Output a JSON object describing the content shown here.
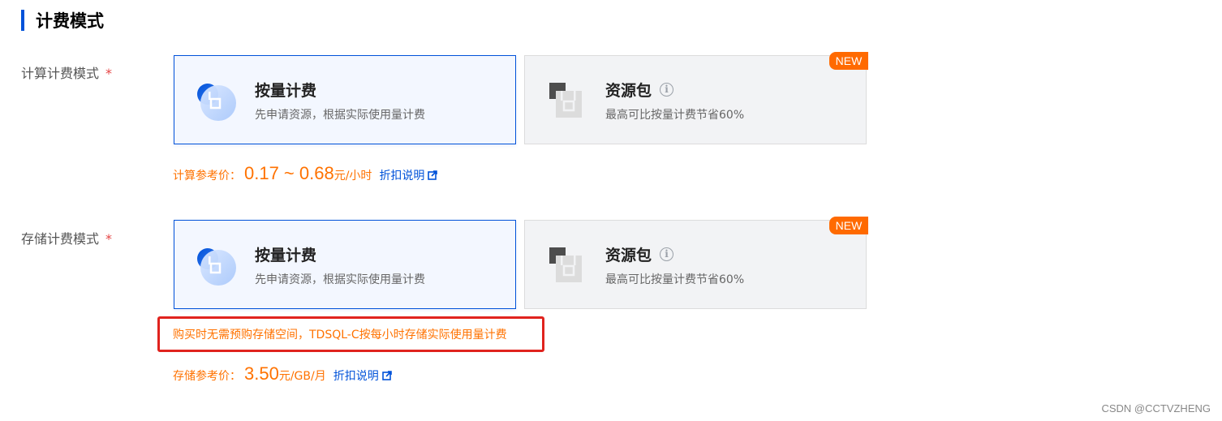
{
  "section": {
    "title": "计费模式"
  },
  "compute": {
    "label": "计算计费模式",
    "required_mark": "*",
    "options": [
      {
        "title": "按量计费",
        "desc": "先申请资源，根据实际使用量计费",
        "icon": "pay-as-you-go-icon",
        "selected": true
      },
      {
        "title": "资源包",
        "desc": "最高可比按量计费节省60%",
        "icon": "resource-pack-icon",
        "badge": "NEW",
        "selected": false
      }
    ],
    "price": {
      "label": "计算参考价：",
      "value": "0.17 ~ 0.68",
      "unit": "元/小时"
    },
    "discount_link": "折扣说明"
  },
  "storage": {
    "label": "存储计费模式",
    "required_mark": "*",
    "options": [
      {
        "title": "按量计费",
        "desc": "先申请资源，根据实际使用量计费",
        "icon": "pay-as-you-go-icon",
        "selected": true
      },
      {
        "title": "资源包",
        "desc": "最高可比按量计费节省60%",
        "icon": "resource-pack-icon",
        "badge": "NEW",
        "selected": false
      }
    ],
    "notice": "购买时无需预购存储空间，TDSQL-C按每小时存储实际使用量计费",
    "price": {
      "label": "存储参考价：",
      "value": "3.50",
      "unit": "元/GB/月"
    },
    "discount_link": "折扣说明"
  },
  "watermark": "CSDN @CCTVZHENG",
  "colors": {
    "accent": "#0052d9",
    "price": "#ff7200",
    "badge": "#ff6a00",
    "highlight_border": "#e0231e"
  }
}
